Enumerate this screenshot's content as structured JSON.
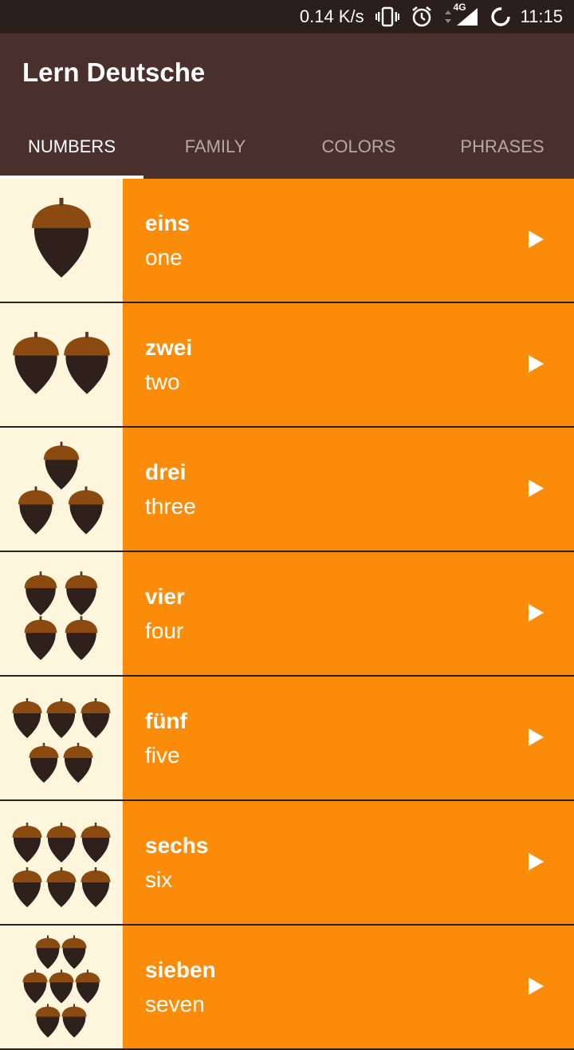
{
  "status_bar": {
    "speed": "0.14 K/s",
    "network": "4G",
    "time": "11:15",
    "icons": [
      "vibrate-icon",
      "alarm-icon",
      "data-arrows-icon",
      "signal-icon",
      "loading-icon"
    ]
  },
  "app": {
    "title": "Lern Deutsche"
  },
  "tabs": [
    {
      "label": "NUMBERS",
      "active": true
    },
    {
      "label": "FAMILY",
      "active": false
    },
    {
      "label": "COLORS",
      "active": false
    },
    {
      "label": "PHRASES",
      "active": false
    }
  ],
  "items": [
    {
      "german": "eins",
      "english": "one",
      "count": 1
    },
    {
      "german": "zwei",
      "english": "two",
      "count": 2
    },
    {
      "german": "drei",
      "english": "three",
      "count": 3
    },
    {
      "german": "vier",
      "english": "four",
      "count": 4
    },
    {
      "german": "fünf",
      "english": "five",
      "count": 5
    },
    {
      "german": "sechs",
      "english": "six",
      "count": 6
    },
    {
      "german": "sieben",
      "english": "seven",
      "count": 7
    }
  ],
  "colors": {
    "status_bar": "#2b1f1c",
    "app_bar": "#4a302c",
    "row_accent": "#fb8c0a",
    "image_bg": "#fdf6dd",
    "acorn_cap": "#8b4a10",
    "acorn_body": "#2f201c"
  }
}
